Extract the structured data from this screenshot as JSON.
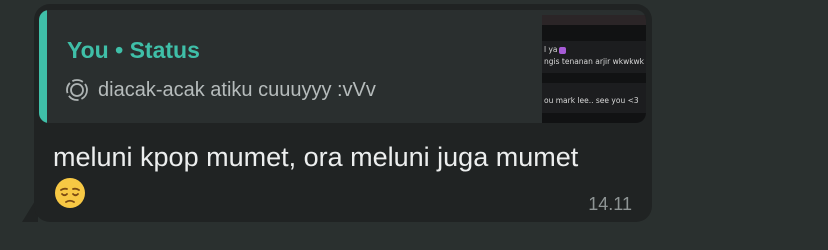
{
  "quote": {
    "author": "You",
    "separator": "•",
    "type": "Status",
    "status_icon": "status-ring-icon",
    "text": "diacak-acak atiku cuuuyyy :vVv",
    "thumbnail": {
      "line1": "l ya",
      "line2": "ngis tenanan arjir wkwkwk",
      "line3": "ou mark lee.. see you <3"
    }
  },
  "message": {
    "text": "meluni kpop mumet, ora meluni juga mumet",
    "emoji": "pensive-face-icon",
    "time": "14.11"
  },
  "colors": {
    "background": "#2a302f",
    "bubble": "#202323",
    "quote_bg": "#2a2f2f",
    "accent": "#3fbfa8",
    "text": "#eceeee",
    "muted": "#8e9494"
  }
}
